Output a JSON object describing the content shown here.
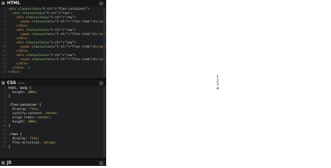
{
  "html_panel": {
    "title": "HTML",
    "lines": [
      {
        "n": "1",
        "text": "<div class=\"flex-container\">"
      },
      {
        "n": "2",
        "text": "  <div class=\"row\">"
      },
      {
        "n": "3",
        "text": "    <div class=\"row\">"
      },
      {
        "n": "4",
        "text": "      <span class=\"flex-item\">1</span>"
      },
      {
        "n": "5",
        "text": "    </div>"
      },
      {
        "n": "6",
        "text": "    <div class=\"row\">"
      },
      {
        "n": "7",
        "text": "      <span class=\"flex-item\">2</span>"
      },
      {
        "n": "8",
        "text": "    </div>"
      },
      {
        "n": "9",
        "text": "    <div class=\"row\">"
      },
      {
        "n": "10",
        "text": "      <span class=\"flex-item\">3</span>"
      },
      {
        "n": "11",
        "text": "    </div>"
      },
      {
        "n": "12",
        "text": "    <div class=\"row\">"
      },
      {
        "n": "13",
        "text": "      <span class=\"flex-item\">4</span>"
      },
      {
        "n": "14",
        "text": "    </div>"
      },
      {
        "n": "15",
        "text": "  </div>  |"
      },
      {
        "n": "16",
        "text": "</div>"
      }
    ]
  },
  "css_panel": {
    "title": "CSS",
    "subtitle": "SCSS",
    "lines": [
      {
        "n": "1",
        "text": "html, body {"
      },
      {
        "n": "2",
        "text": "  height: 100%;"
      },
      {
        "n": "3",
        "text": "}"
      },
      {
        "n": "4",
        "text": ""
      },
      {
        "n": "5",
        "text": ".flex-container {"
      },
      {
        "n": "6",
        "text": "  display: flex;"
      },
      {
        "n": "7",
        "text": "  justify-content: center;"
      },
      {
        "n": "8",
        "text": "  align-items: center;"
      },
      {
        "n": "9",
        "text": "  height: 100%;"
      },
      {
        "n": "10",
        "text": "}"
      },
      {
        "n": "11",
        "text": ""
      },
      {
        "n": "12",
        "text": ".rows {"
      },
      {
        "n": "13",
        "text": "  display: flex;"
      },
      {
        "n": "14",
        "text": "  flex-direction: column;"
      },
      {
        "n": "15",
        "text": "}"
      }
    ]
  },
  "js_panel": {
    "title": "JS"
  },
  "panel_icon": "gear-icon",
  "panel_button": "chevron-down-icon",
  "output": {
    "items": [
      "1",
      "2",
      "3",
      "4"
    ]
  },
  "colors": {
    "editor_bg": "#1d1f20",
    "header_bg": "#151718",
    "tag": "#d7a35c",
    "string": "#94c36b"
  }
}
